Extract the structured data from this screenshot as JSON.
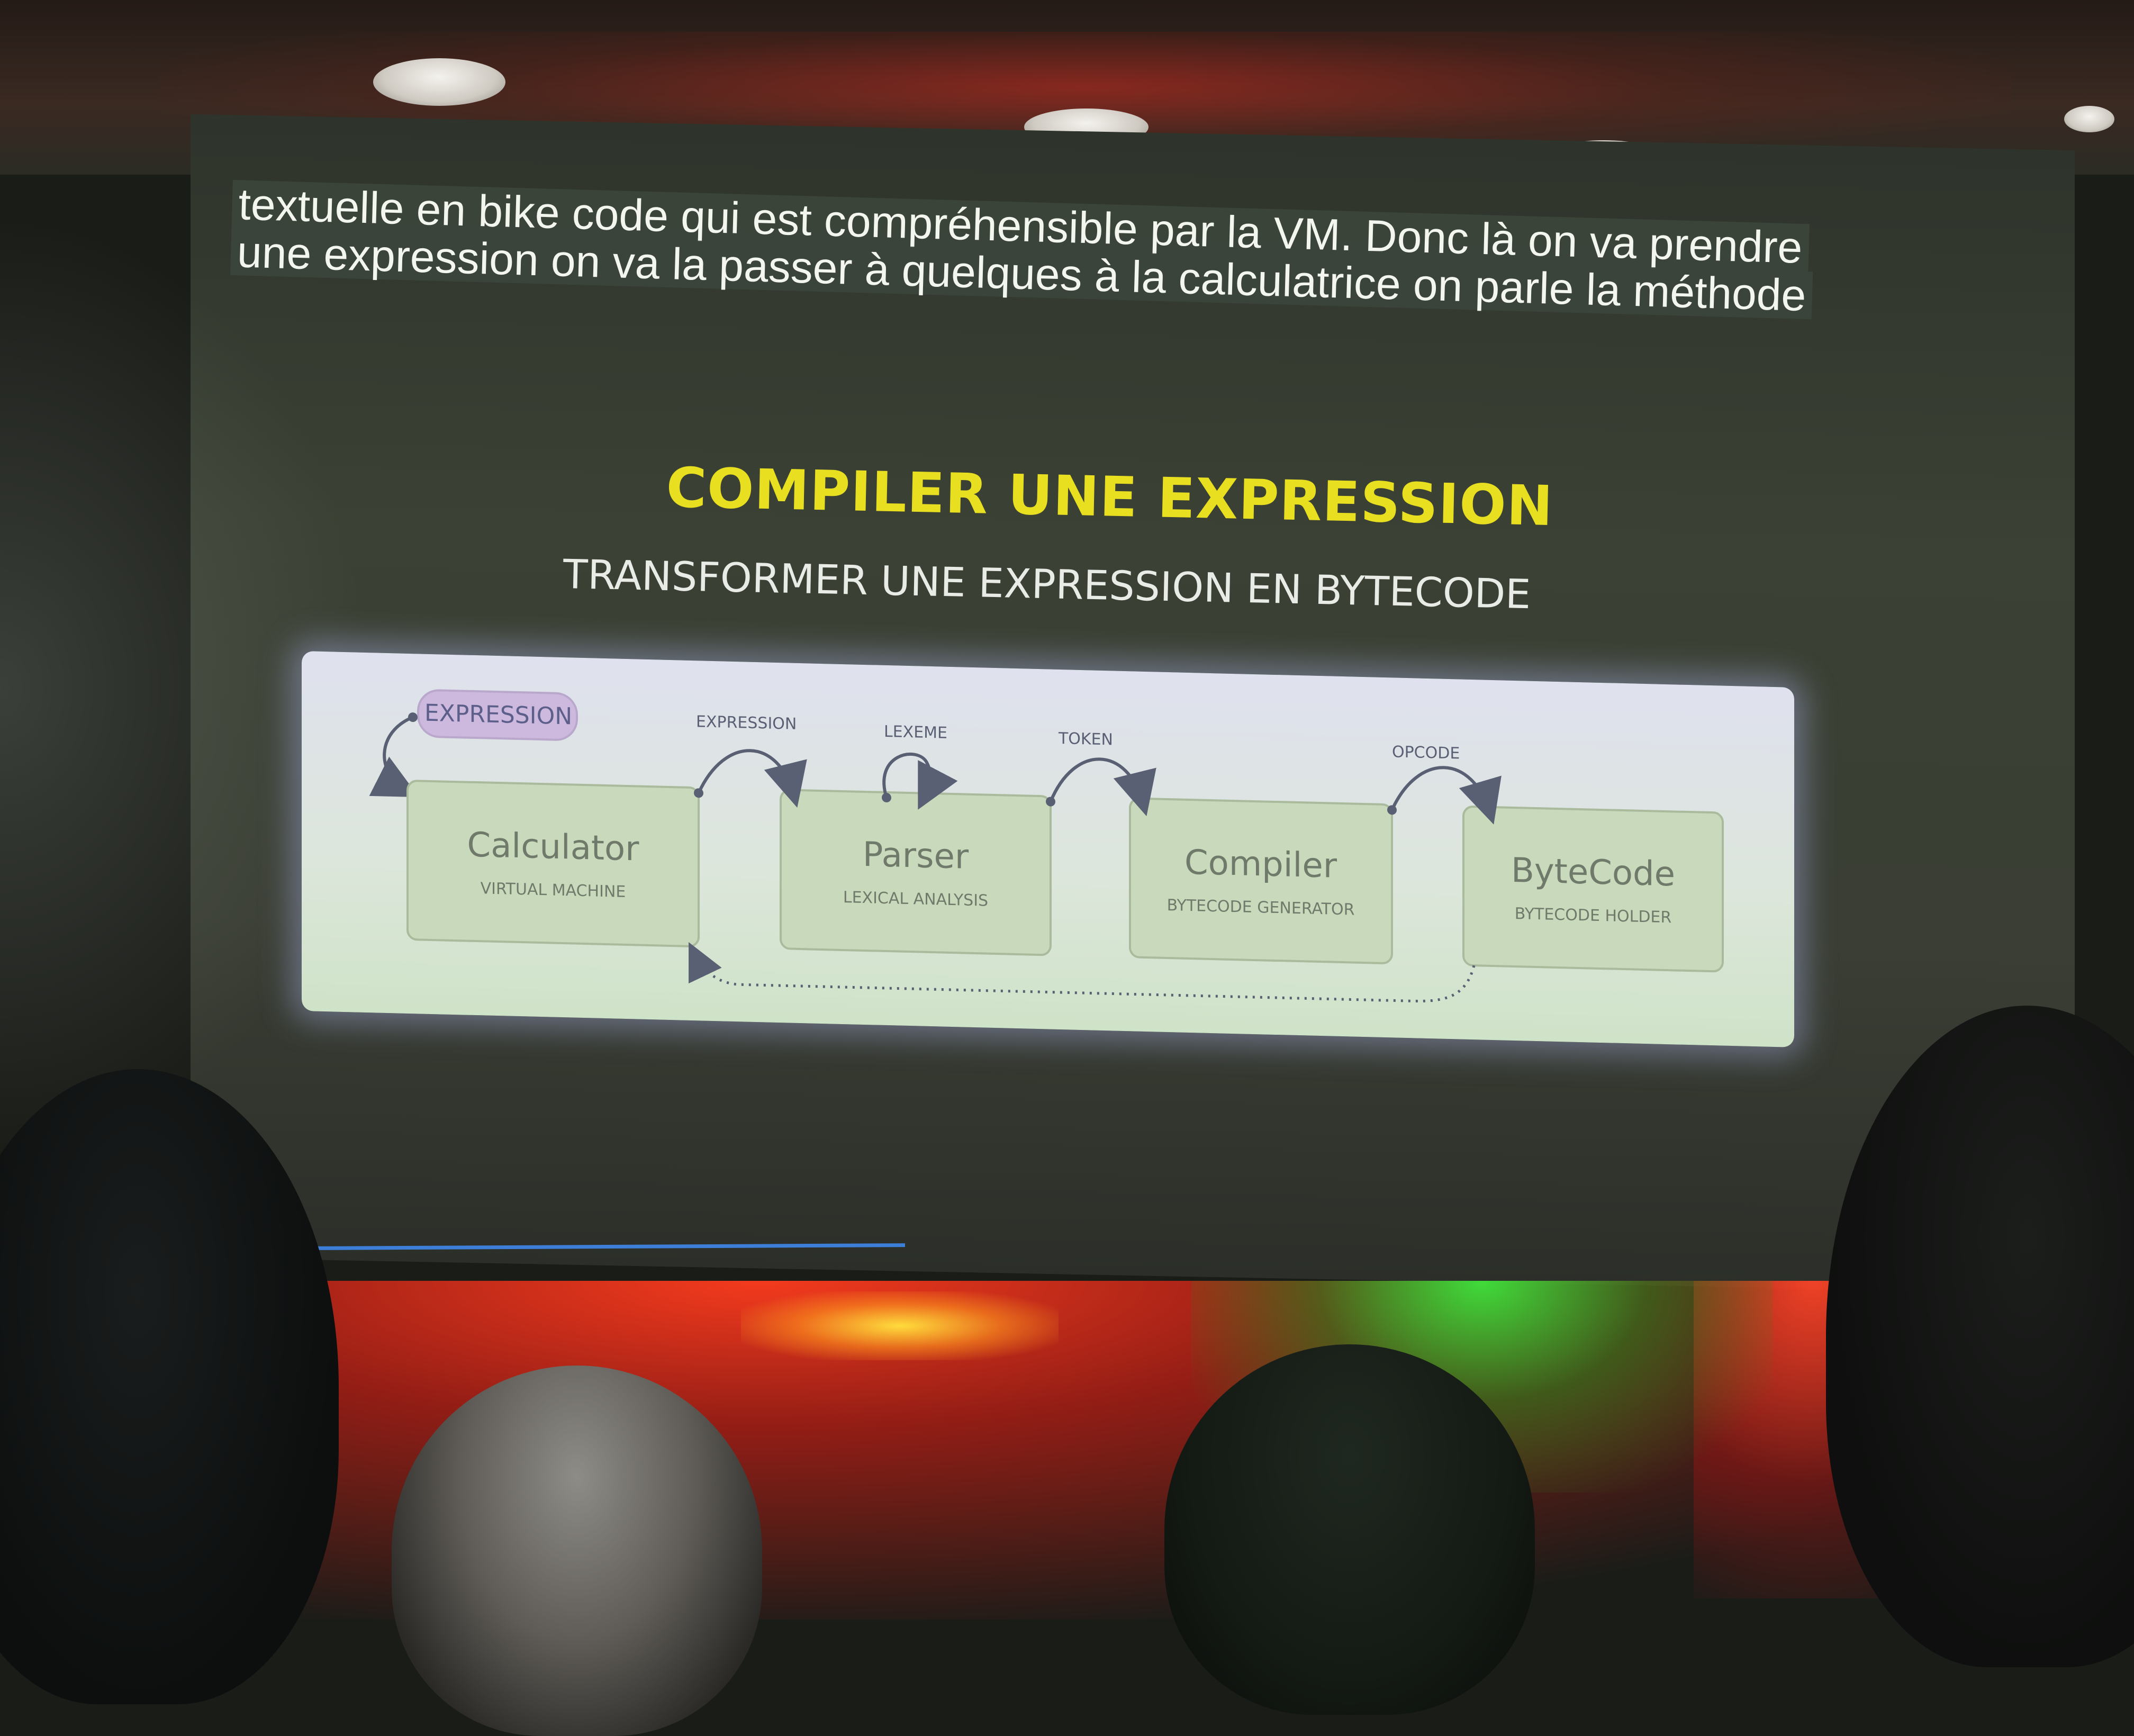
{
  "caption": {
    "line1": "textuelle en bike code qui est compréhensible par la VM. Donc là on va prendre",
    "line2": "une expression on va la passer à quelques à la calculatrice on parle la méthode"
  },
  "slide": {
    "title": "COMPILER UNE EXPRESSION",
    "subtitle": "TRANSFORMER UNE EXPRESSION EN BYTECODE"
  },
  "diagram": {
    "input_label": "EXPRESSION",
    "nodes": [
      {
        "title": "Calculator",
        "subtitle": "VIRTUAL MACHINE"
      },
      {
        "title": "Parser",
        "subtitle": "LEXICAL ANALYSIS"
      },
      {
        "title": "Compiler",
        "subtitle": "BYTECODE GENERATOR"
      },
      {
        "title": "ByteCode",
        "subtitle": "BYTECODE HOLDER"
      }
    ],
    "edges": [
      {
        "label": "EXPRESSION"
      },
      {
        "label": "LEXEME"
      },
      {
        "label": "TOKEN"
      },
      {
        "label": "OPCODE"
      }
    ]
  },
  "colors": {
    "title": "#e8df20",
    "subtitle": "#e9ece6",
    "progress_line": "#3d7fd8",
    "node_fill": "#c9d9bb",
    "input_badge": "#cdb9dd"
  }
}
